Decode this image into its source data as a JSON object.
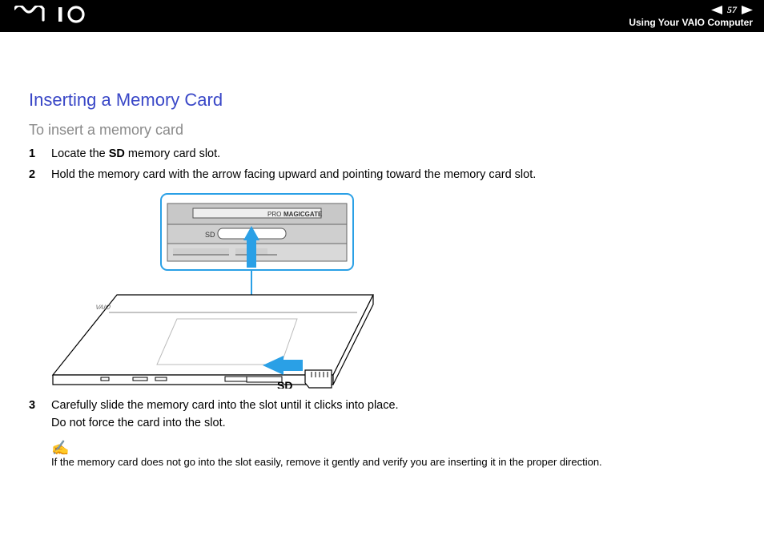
{
  "header": {
    "page_number": "57",
    "section": "Using Your VAIO Computer",
    "logo_text": "VAIO"
  },
  "title": "Inserting a Memory Card",
  "subtitle": "To insert a memory card",
  "steps": [
    {
      "num": "1",
      "text_pre": "Locate the ",
      "bold": "SD",
      "text_post": " memory card slot."
    },
    {
      "num": "2",
      "text_pre": "Hold the memory card with the arrow facing upward and pointing toward the memory card slot.",
      "bold": "",
      "text_post": ""
    },
    {
      "num": "3",
      "text_pre": "Carefully slide the memory card into the slot until it clicks into place.",
      "bold": "",
      "text_post": "",
      "line2": "Do not force the card into the slot."
    }
  ],
  "figure": {
    "callout_labels": {
      "pro": "PRO",
      "magicgate": "MAGICGATE",
      "sd_small": "SD"
    },
    "sd_label": "SD"
  },
  "note": {
    "icon": "✍",
    "text": "If the memory card does not go into the slot easily, remove it gently and verify you are inserting it in the proper direction."
  }
}
